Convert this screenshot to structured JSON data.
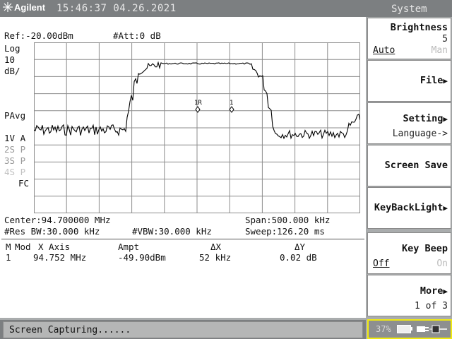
{
  "header": {
    "brand": "Agilent",
    "datetime": "15:46:37  04.26.2021",
    "menu_title": "System"
  },
  "screen": {
    "ref_level": "Ref:-20.00dBm",
    "attenuation": "#Att:0 dB",
    "scale_lines": [
      "Log",
      "10",
      "dB/"
    ],
    "detector": "PAvg",
    "traces": [
      {
        "label": "1V",
        "mode": "A"
      },
      {
        "label": "2S",
        "mode": "P"
      },
      {
        "label": "3S",
        "mode": "P"
      },
      {
        "label": "4S",
        "mode": "P"
      }
    ],
    "fc": "FC",
    "center": "Center:94.700000 MHz",
    "span": "Span:500.000 kHz",
    "res_bw": "#Res BW:30.000 kHz",
    "vbw": "#VBW:30.000 kHz",
    "sweep": "Sweep:126.20 ms",
    "marker_labels": [
      "1R",
      "1"
    ]
  },
  "marker_table": {
    "headers": {
      "m": "M",
      "mod": "Mod",
      "x_axis": "X Axis",
      "ampt": "Ampt",
      "dx": "ΔX",
      "dy": "ΔY"
    },
    "rows": [
      {
        "m": "1",
        "mod": "",
        "x_axis": "94.752 MHz",
        "ampt": "-49.90dBm",
        "dx": "52 kHz",
        "dy": "0.02 dB"
      }
    ]
  },
  "status_bar": {
    "text": "Screen Capturing......"
  },
  "softkeys": [
    {
      "label": "Brightness",
      "value": "5",
      "opt_on": "Auto",
      "opt_off": "Man"
    },
    {
      "label": "File"
    },
    {
      "label": "Setting",
      "sub": "Language->"
    },
    {
      "label": "Screen Save"
    },
    {
      "label": "KeyBackLight"
    },
    {
      "label": "Key Beep",
      "opt_on": "Off",
      "opt_off": "On"
    },
    {
      "label": "More",
      "sub": "1 of 3"
    }
  ],
  "battery": {
    "percent_text": "37%"
  },
  "colors": {
    "trace": "#000000",
    "grid": "#8c8c8c",
    "header_bg": "#7c7f81",
    "battery_border": "#f0ea10"
  }
}
